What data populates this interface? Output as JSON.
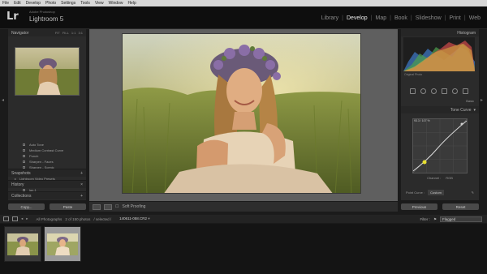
{
  "menubar": {
    "items": [
      "File",
      "Edit",
      "Develop",
      "Photo",
      "Settings",
      "Tools",
      "View",
      "Window",
      "Help"
    ]
  },
  "app": {
    "logo": "Lr",
    "subtitle": "Adobe Photoshop",
    "name": "Lightroom 5"
  },
  "modules": [
    "Library",
    "Develop",
    "Map",
    "Book",
    "Slideshow",
    "Print",
    "Web"
  ],
  "active_module": "Develop",
  "left_panel": {
    "navigator": {
      "title": "Navigator",
      "options": [
        "FIT",
        "FILL",
        "1:1",
        "3:1"
      ]
    },
    "presets": [
      {
        "label": "Auto Tone",
        "type": "item"
      },
      {
        "label": "Medium Contrast Curve",
        "type": "item"
      },
      {
        "label": "Punch",
        "type": "item"
      },
      {
        "label": "Sharpen - Faces",
        "type": "item"
      },
      {
        "label": "Sharpen - Scenic",
        "type": "item"
      },
      {
        "label": "Zeroed",
        "type": "item"
      },
      {
        "label": "Lightroom Video Presets",
        "type": "group"
      },
      {
        "label": "User Presets",
        "type": "group-open"
      },
      {
        "label": "laz-1",
        "type": "item"
      }
    ],
    "sections": [
      "Snapshots",
      "History",
      "Collections"
    ],
    "copy_button": "Copy...",
    "paste_button": "Paste"
  },
  "toolbar": {
    "soft_proofing": "Soft Proofing"
  },
  "right_panel": {
    "histogram_title": "Histogram",
    "histogram_info": "Original Photo",
    "basic_label": "Basic",
    "tone_curve_title": "Tone Curve",
    "curve_readout": "93.3 / 107 %",
    "channel_label": "Channel :",
    "channel_value": "RGB",
    "point_curve_label": "Point Curve :",
    "point_curve_value": "Custom",
    "previous_button": "Previous",
    "reset_button": "Reset"
  },
  "filmbar": {
    "source": "All Photographs",
    "count": "2 of 150 photos",
    "selected_label": "/ selected /",
    "filename": "140611-058.CR2",
    "filter_label": "Filter :",
    "filter_value": "Flagged"
  },
  "colors": {
    "accent": "#eaeaea",
    "panel": "#2b2b2b",
    "background": "#1b1b1b"
  }
}
